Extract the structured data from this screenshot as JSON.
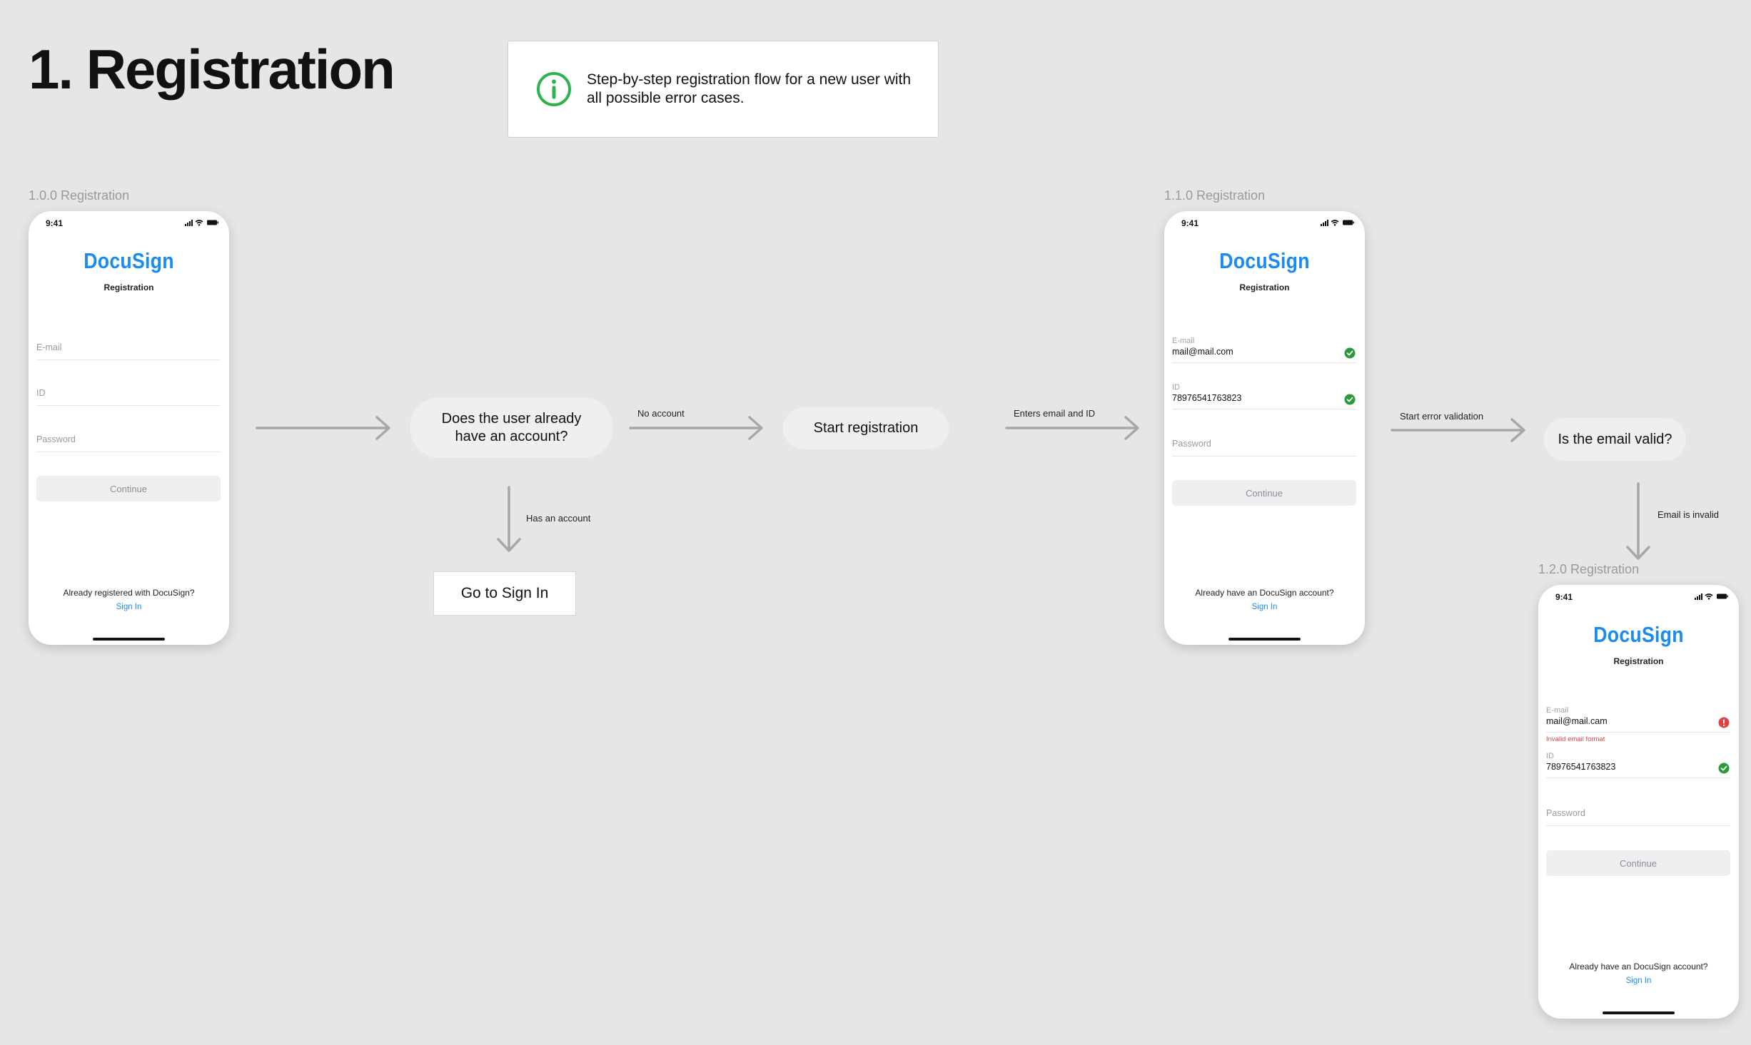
{
  "page": {
    "title": "1. Registration",
    "info": "Step-by-step registration flow for a new user with all possible error cases."
  },
  "colors": {
    "background": "#e6e6e6",
    "brand": "#1a8bf0",
    "success": "#2b9a3b",
    "error": "#e04343",
    "info": "#2fb24c"
  },
  "icons": {
    "info": "info-circle-icon",
    "valid": "check-circle-icon",
    "invalid": "exclamation-circle-icon"
  },
  "screens": [
    {
      "label": "1.0.0 Registration",
      "time": "9:41",
      "brand": "DocuSign",
      "subtitle": "Registration",
      "email_label": "E-mail",
      "id_label": "ID",
      "password_label": "Password",
      "continue": "Continue",
      "footer": "Already registered with DocuSign?",
      "signin": "Sign In"
    },
    {
      "label": "1.1.0 Registration",
      "time": "9:41",
      "brand": "DocuSign",
      "subtitle": "Registration",
      "email_label": "E-mail",
      "email_value": "mail@mail.com",
      "id_label": "ID",
      "id_value": "78976541763823",
      "password_label": "Password",
      "continue": "Continue",
      "footer": "Already have an DocuSign account?",
      "signin": "Sign In"
    },
    {
      "label": "1.2.0 Registration",
      "time": "9:41",
      "brand": "DocuSign",
      "subtitle": "Registration",
      "email_label": "E-mail",
      "email_value": "mail@mail.cam",
      "email_error": "Invalid email format",
      "id_label": "ID",
      "id_value": "78976541763823",
      "password_label": "Password",
      "continue": "Continue",
      "footer": "Already have an DocuSign account?",
      "signin": "Sign In"
    }
  ],
  "nodes": {
    "has_account_question": "Does the user already have an account?",
    "go_to_signin": "Go to Sign In",
    "start_registration": "Start registration",
    "email_valid_question": "Is the email valid?"
  },
  "edges": {
    "no_account": "No account",
    "has_account": "Has an account",
    "enters_email_id": "Enters email and ID",
    "start_error_validation": "Start error validation",
    "email_invalid": "Email is invalid"
  }
}
